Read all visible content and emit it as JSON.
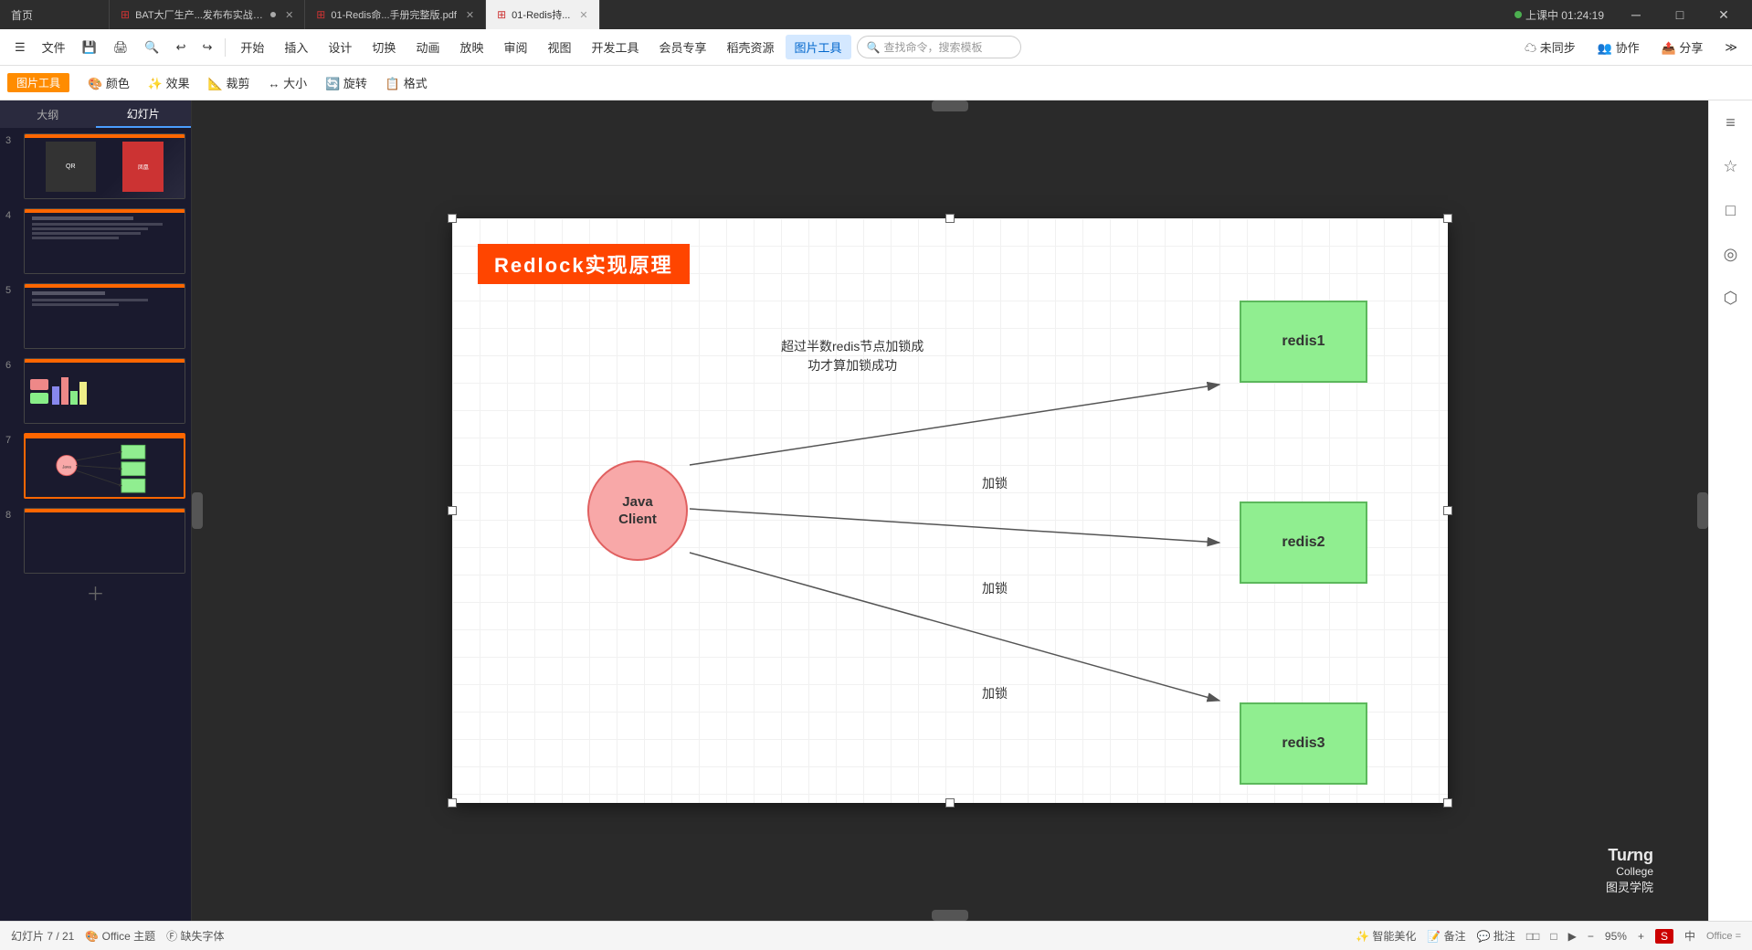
{
  "titleBar": {
    "tabs": [
      {
        "label": "首页",
        "active": false,
        "id": "home"
      },
      {
        "label": "BAT大厂生产...发布布实战实战",
        "active": false,
        "id": "bat",
        "icon": "ppt",
        "closable": true
      },
      {
        "label": "01-Redis命...手册完整版.pdf",
        "active": false,
        "id": "redis-pdf",
        "icon": "pdf",
        "closable": true
      },
      {
        "label": "01-Redis持...",
        "active": true,
        "id": "redis-ppt",
        "icon": "ppt",
        "closable": true
      }
    ],
    "liveIndicator": "上课中 01:24:19",
    "windowControls": [
      "─",
      "□",
      "✕"
    ]
  },
  "menuBar": {
    "items": [
      "开始",
      "插入",
      "设计",
      "切换",
      "动画",
      "放映",
      "审阅",
      "视图",
      "开发工具",
      "会员专享",
      "稻壳资源",
      "图片工具"
    ],
    "activeItem": "图片工具",
    "fileMenu": "文件",
    "toolbar": {
      "undo": "↩",
      "redo": "↪",
      "save": "💾"
    },
    "search": {
      "placeholder": "查找命令，搜索模板"
    },
    "rightItems": [
      "未同步",
      "协作",
      "分享"
    ]
  },
  "sidebar": {
    "tabs": [
      "大纲",
      "幻灯片"
    ],
    "activeTab": "幻灯片",
    "slides": [
      {
        "number": 3,
        "active": false,
        "id": "slide-3"
      },
      {
        "number": 4,
        "active": false,
        "id": "slide-4"
      },
      {
        "number": 5,
        "active": false,
        "id": "slide-5"
      },
      {
        "number": 6,
        "active": false,
        "id": "slide-6"
      },
      {
        "number": 7,
        "active": true,
        "id": "slide-7"
      },
      {
        "number": 8,
        "active": false,
        "id": "slide-8"
      }
    ],
    "addSlideLabel": "+"
  },
  "slide": {
    "title": "Redlock实现原理",
    "diagram": {
      "javaClient": {
        "label": "Java\nClient"
      },
      "annotation": "超过半数redis节点加锁成\n功才算加锁成功",
      "lockLabels": [
        "加锁",
        "加锁",
        "加锁"
      ],
      "redisNodes": [
        "redis1",
        "redis2",
        "redis3"
      ]
    }
  },
  "statusBar": {
    "slideInfo": "幻灯片 7 / 21",
    "theme": "Office 主题",
    "missingFont": "缺失字体",
    "tools": [
      "智能美化",
      "备注",
      "批注"
    ],
    "viewButtons": [
      "□□",
      "□",
      "□"
    ],
    "zoom": "95%",
    "zoomOut": "−",
    "zoomIn": "+",
    "inputMethod": "中",
    "officeLabel": "Office ="
  },
  "rightPanel": {
    "icons": [
      "≡",
      "☆",
      "□",
      "◎",
      "⬡"
    ]
  },
  "colors": {
    "slideBackground": "#ffffff",
    "titleBanner": "#ff4500",
    "javaClientCircle": "#f8a8a8",
    "redisBox": "#90ee90",
    "diagramBackground": "#ffffff",
    "accent": "#ff6600"
  }
}
